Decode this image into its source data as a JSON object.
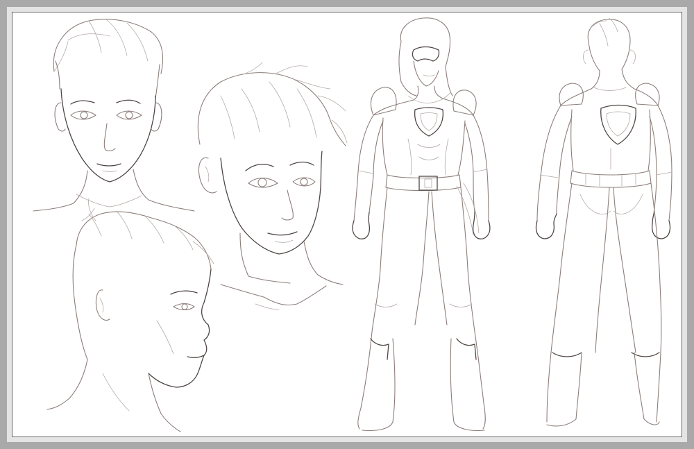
{
  "sheet": {
    "background_color": "#a9a9a9",
    "paper_color": "#ffffff",
    "line_color": "#8c7e7a"
  },
  "drawings": [
    {
      "name": "front-view-head",
      "icon": "head-sketch"
    },
    {
      "name": "three-quarter-view-head",
      "icon": "head-sketch"
    },
    {
      "name": "profile-view-head",
      "icon": "head-sketch"
    },
    {
      "name": "full-body-front-view",
      "icon": "figure-sketch"
    },
    {
      "name": "full-body-back-view",
      "icon": "figure-sketch"
    }
  ]
}
